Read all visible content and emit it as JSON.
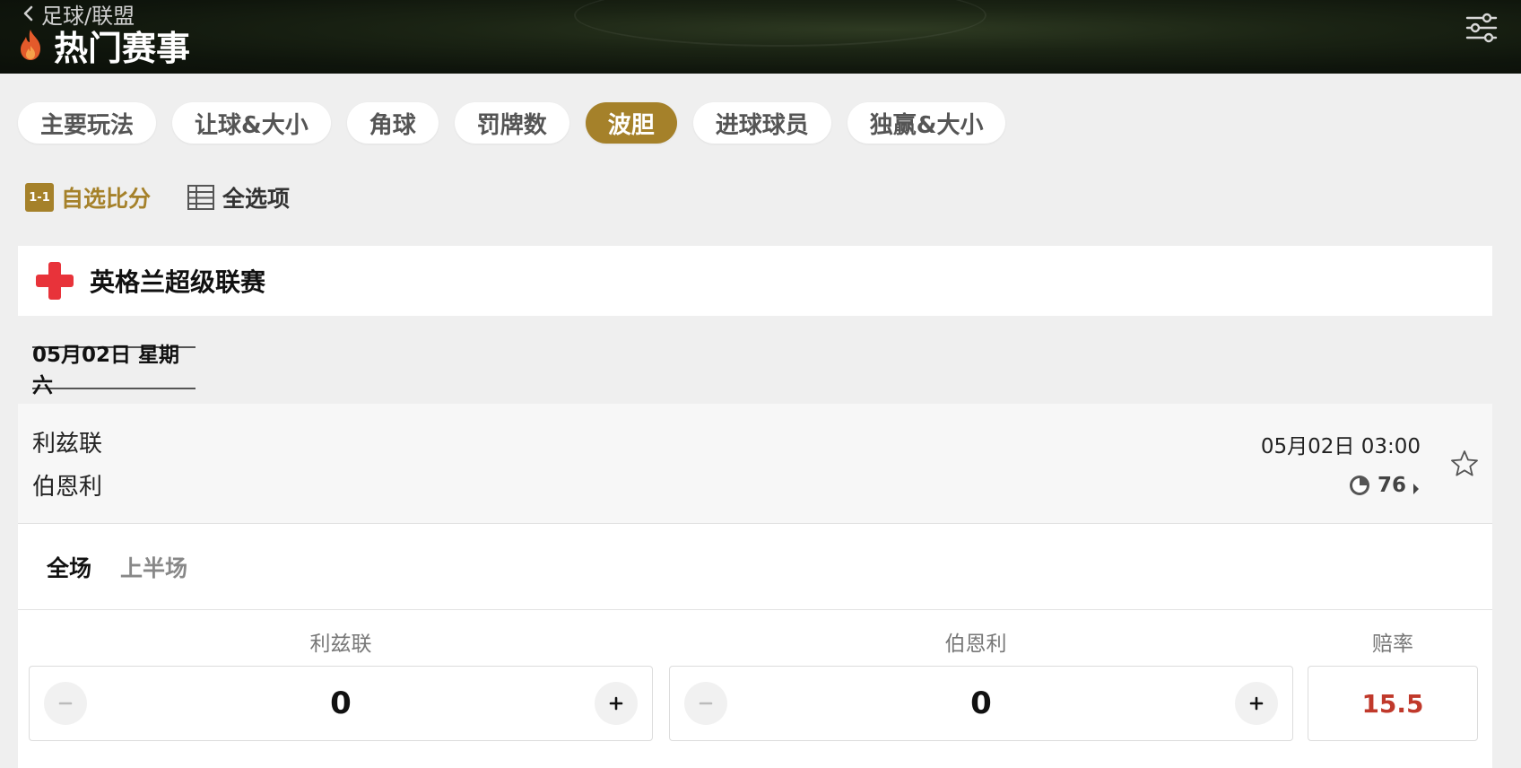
{
  "header": {
    "back_label": "足球/联盟",
    "title": "热门赛事"
  },
  "tabs": [
    {
      "label": "主要玩法",
      "active": false
    },
    {
      "label": "让球&大小",
      "active": false
    },
    {
      "label": "角球",
      "active": false
    },
    {
      "label": "罚牌数",
      "active": false
    },
    {
      "label": "波胆",
      "active": true
    },
    {
      "label": "进球球员",
      "active": false
    },
    {
      "label": "独赢&大小",
      "active": false
    }
  ],
  "options": {
    "custom_badge": "1-1",
    "custom_label": "自选比分",
    "all_label": "全选项"
  },
  "league": {
    "name": "英格兰超级联赛"
  },
  "date_label": "05月02日 星期六",
  "match": {
    "home": "利兹联",
    "away": "伯恩利",
    "time": "05月02日 03:00",
    "markets_count": "76"
  },
  "period_tabs": [
    {
      "label": "全场",
      "active": true
    },
    {
      "label": "上半场",
      "active": false
    }
  ],
  "picker": {
    "home_label": "利兹联",
    "away_label": "伯恩利",
    "odds_label": "赔率",
    "home_score": "0",
    "away_score": "0",
    "odds": "15.5"
  },
  "colors": {
    "accent": "#a5812a",
    "odds": "#c0392b",
    "league_flag": "#e8333a"
  }
}
